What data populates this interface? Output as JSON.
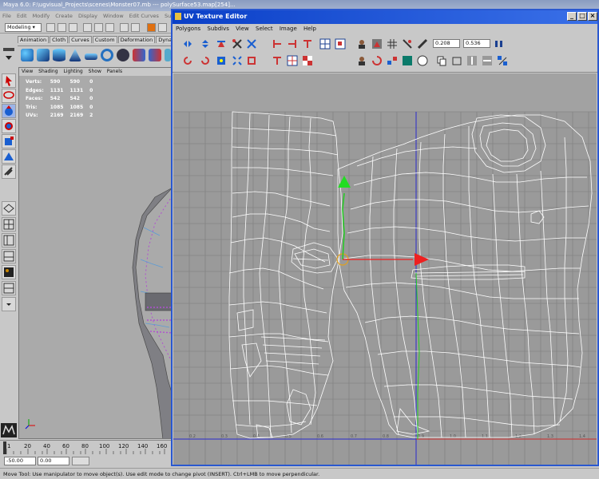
{
  "maya": {
    "title": "Maya 6.0: F:\\ugvisual_Projects\\scenes\\Monster07.mb  ---  polySurface53.map[254]...",
    "menus": [
      "File",
      "Edit",
      "Modify",
      "Create",
      "Display",
      "Window",
      "Edit Curves",
      "Surfaces"
    ],
    "mode": "Modeling",
    "shelf_tabs": [
      "Animation",
      "Cloth",
      "Curves",
      "Custom",
      "Deformation",
      "Dynamics"
    ],
    "viewport_menus": [
      "View",
      "Shading",
      "Lighting",
      "Show",
      "Panels"
    ],
    "hud": [
      {
        "label": "Verts:",
        "a": "590",
        "b": "590",
        "c": "0"
      },
      {
        "label": "Edges:",
        "a": "1131",
        "b": "1131",
        "c": "0"
      },
      {
        "label": "Faces:",
        "a": "542",
        "b": "542",
        "c": "0"
      },
      {
        "label": "Tris:",
        "a": "1085",
        "b": "1085",
        "c": "0"
      },
      {
        "label": "UVs:",
        "a": "2169",
        "b": "2169",
        "c": "2"
      }
    ],
    "timeline_ticks": [
      "1",
      "20",
      "40",
      "60",
      "80",
      "100",
      "120",
      "140",
      "160"
    ],
    "range_start": "-50.00",
    "range_current": "0.00",
    "help_line": "Move Tool: Use manipulator to move object(s). Use edit mode to change pivot (INSERT). Ctrl+LMB to move perpendicular."
  },
  "uv_editor": {
    "title": "UV Texture Editor",
    "menus": [
      "Polygons",
      "Subdivs",
      "View",
      "Select",
      "Image",
      "Help"
    ],
    "u_value": "0.208",
    "v_value": "0.536",
    "grid_labels_bottom": [
      "0.2",
      "0.3",
      "0.4",
      "0.5",
      "0.6",
      "0.7",
      "0.8",
      "0.9",
      "1.0",
      "1.1",
      "1.2",
      "1.3",
      "1.4",
      "1.5"
    ],
    "window_buttons": [
      "_",
      "□",
      "×"
    ],
    "colors": {
      "title_bar": "#0a3fc7",
      "uv_lines": "#ffffff",
      "u_axis": "#ff2020",
      "v_axis": "#20c020",
      "canvas": "#9a9a9a",
      "grid": "#7c7c7c"
    }
  }
}
